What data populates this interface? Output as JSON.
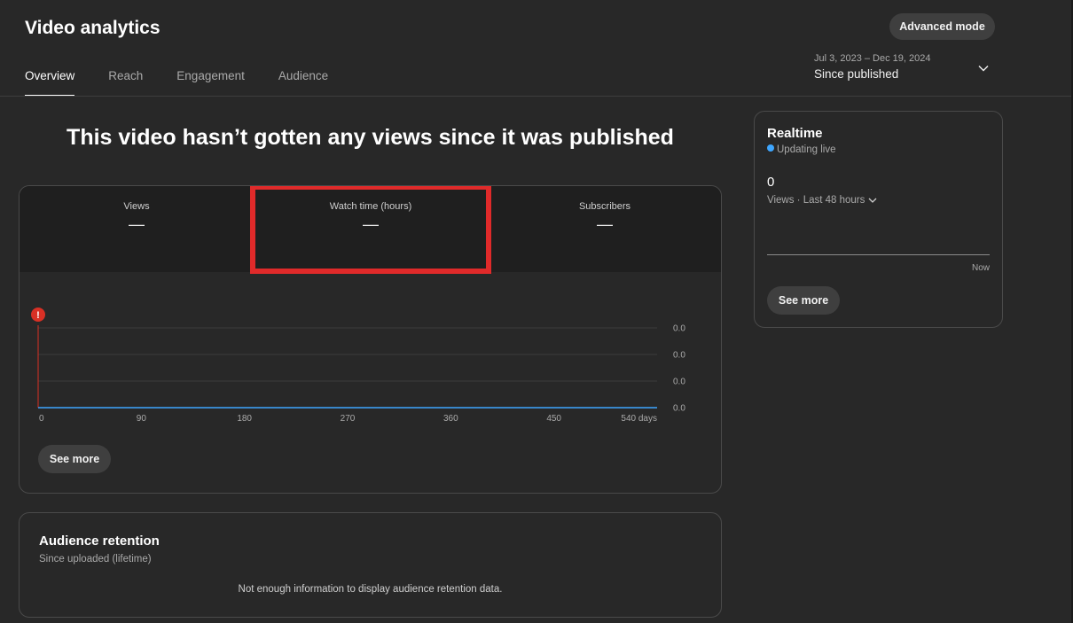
{
  "header": {
    "title": "Video analytics",
    "advanced_mode_label": "Advanced mode",
    "tabs": [
      {
        "label": "Overview",
        "active": true
      },
      {
        "label": "Reach",
        "active": false
      },
      {
        "label": "Engagement",
        "active": false
      },
      {
        "label": "Audience",
        "active": false
      }
    ],
    "date_range": "Jul 3, 2023 – Dec 19, 2024",
    "date_preset": "Since published"
  },
  "main": {
    "headline": "This video hasn’t gotten any views since it was published",
    "metrics": [
      {
        "label": "Views",
        "value": "—"
      },
      {
        "label": "Watch time (hours)",
        "value": "—"
      },
      {
        "label": "Subscribers",
        "value": "—"
      }
    ],
    "see_more_label": "See more"
  },
  "chart_data": {
    "type": "line",
    "x_ticks": [
      "0",
      "90",
      "180",
      "270",
      "360",
      "450",
      "540 days"
    ],
    "y_ticks": [
      "0.0",
      "0.0",
      "0.0",
      "0.0"
    ],
    "xlim": [
      0,
      540
    ],
    "series": [
      {
        "x": [
          0,
          540
        ],
        "y": [
          0,
          0
        ],
        "color": "#3ea6ff"
      }
    ],
    "grid": true,
    "marker_icon": "alert-icon",
    "marker_color": "#d93025"
  },
  "retention": {
    "title": "Audience retention",
    "subtitle": "Since uploaded (lifetime)",
    "message": "Not enough information to display audience retention data."
  },
  "realtime": {
    "title": "Realtime",
    "status": "Updating live",
    "count": "0",
    "metric_label": "Views · Last 48 hours",
    "now_label": "Now",
    "see_more_label": "See more"
  },
  "colors": {
    "background": "#282828",
    "accent": "#3ea6ff",
    "highlight": "#e02a2a"
  }
}
